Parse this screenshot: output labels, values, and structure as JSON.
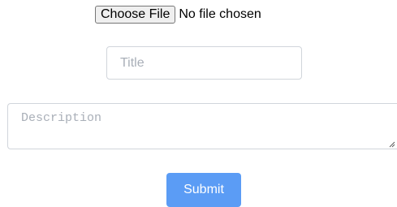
{
  "file_input": {
    "button_label": "Choose File",
    "status_text": "No file chosen"
  },
  "title_input": {
    "value": "",
    "placeholder": "Title"
  },
  "description_input": {
    "value": "",
    "placeholder": "Description"
  },
  "submit": {
    "label": "Submit"
  },
  "colors": {
    "submit_background": "#5b9cf5",
    "input_border": "#d1d5db",
    "placeholder": "#a9afb8"
  }
}
